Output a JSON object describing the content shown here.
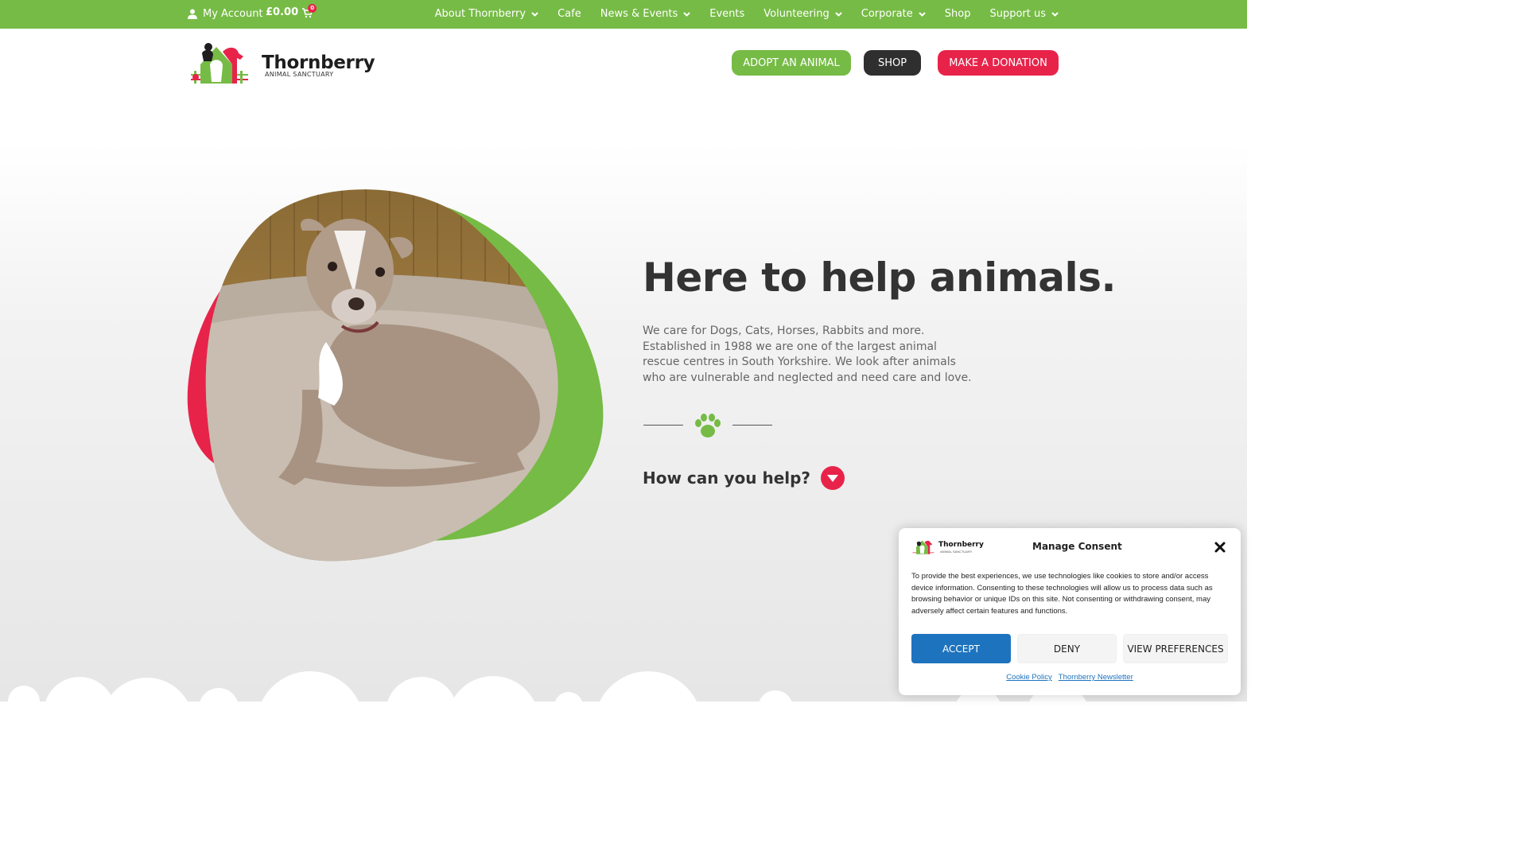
{
  "colors": {
    "brand_green": "#76bb45",
    "brand_pink": "#e8234a",
    "dark": "#2f2f2f",
    "consent_blue": "#1e73be"
  },
  "topbar": {
    "account_label": "My Account",
    "cart_total": "£0.00",
    "cart_count": "0",
    "nav": [
      {
        "label": "About Thornberry",
        "dropdown": true
      },
      {
        "label": "Cafe",
        "dropdown": false
      },
      {
        "label": "News & Events",
        "dropdown": true
      },
      {
        "label": "Events",
        "dropdown": false
      },
      {
        "label": "Volunteering",
        "dropdown": true
      },
      {
        "label": "Corporate",
        "dropdown": true
      },
      {
        "label": "Shop",
        "dropdown": false
      },
      {
        "label": "Support us",
        "dropdown": true
      }
    ]
  },
  "header": {
    "logo_name": "Thornberry",
    "logo_subtitle": "ANIMAL SANCTUARY",
    "adopt_label": "ADOPT AN ANIMAL",
    "shop_label": "SHOP",
    "donate_label": "MAKE A DONATION"
  },
  "hero": {
    "headline": "Here to help animals.",
    "intro": "We care for Dogs, Cats, Horses, Rabbits and more. Established in 1988 we are one of the largest animal rescue centres in South Yorkshire. We look after animals who are vulnerable and neglected and need care and love.",
    "help_label": "How can you help?",
    "image_alt": "dog-photo"
  },
  "consent": {
    "logo_name": "Thornberry",
    "logo_subtitle": "ANIMAL SANCTUARY",
    "title": "Manage Consent",
    "body": "To provide the best experiences, we use technologies like cookies to store and/or access device information. Consenting to these technologies will allow us to process data such as browsing behavior or unique IDs on this site. Not consenting or withdrawing consent, may adversely affect certain features and functions.",
    "accept_label": "ACCEPT",
    "deny_label": "DENY",
    "preferences_label": "VIEW PREFERENCES",
    "links": [
      "Cookie Policy",
      "Thornberry Newsletter"
    ]
  }
}
